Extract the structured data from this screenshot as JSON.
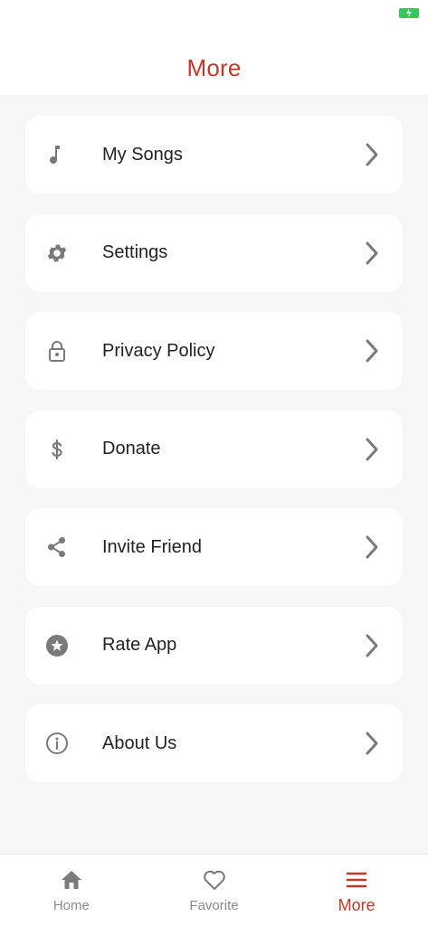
{
  "header": {
    "title": "More"
  },
  "colors": {
    "accent": "#c0392b",
    "icon": "#7a7a7a",
    "battery": "#35c759"
  },
  "menu": {
    "items": [
      {
        "label": "My Songs",
        "icon": "music-note-icon"
      },
      {
        "label": "Settings",
        "icon": "gear-icon"
      },
      {
        "label": "Privacy Policy",
        "icon": "lock-icon"
      },
      {
        "label": "Donate",
        "icon": "dollar-icon"
      },
      {
        "label": "Invite Friend",
        "icon": "share-icon"
      },
      {
        "label": "Rate App",
        "icon": "star-badge-icon"
      },
      {
        "label": "About Us",
        "icon": "info-icon"
      }
    ]
  },
  "tabbar": {
    "tabs": [
      {
        "label": "Home",
        "icon": "home-icon"
      },
      {
        "label": "Favorite",
        "icon": "heart-icon"
      },
      {
        "label": "More",
        "icon": "hamburger-icon",
        "active": true
      }
    ]
  }
}
